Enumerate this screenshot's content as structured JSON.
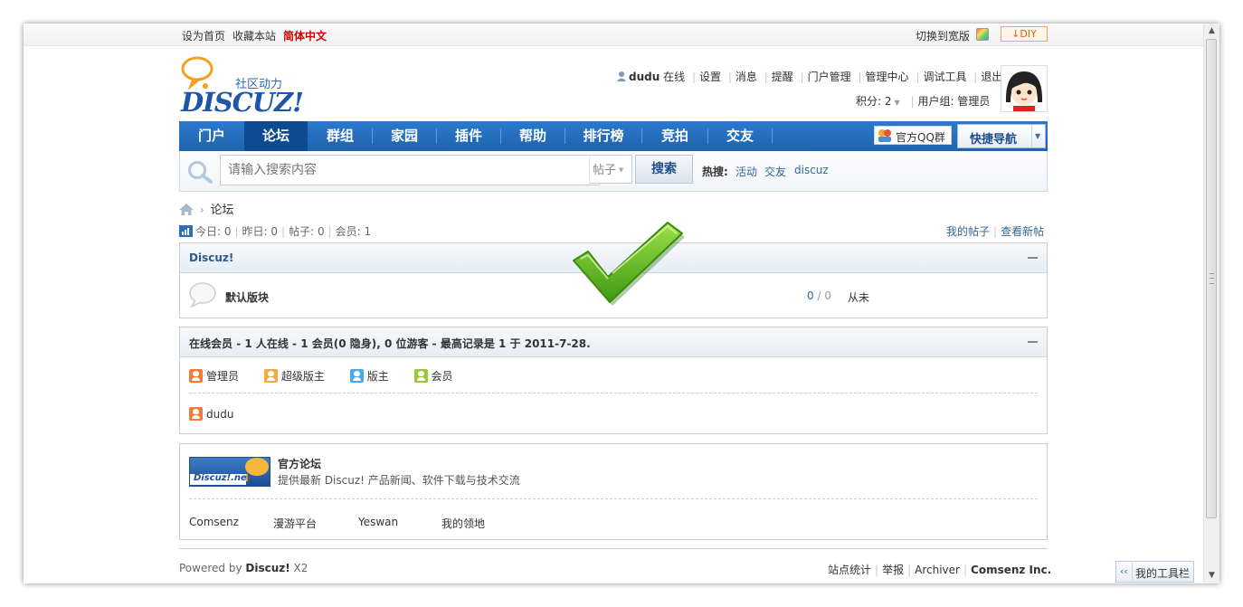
{
  "topbar": {
    "set_home": "设为首页",
    "bookmark": "收藏本站",
    "language": "简体中文",
    "switch_wide": "切换到宽版",
    "diy": "DIY"
  },
  "logo": {
    "brand": "DISCUZ!",
    "tagline": "社区动力"
  },
  "user": {
    "name": "dudu",
    "status": "在线",
    "links": [
      "设置",
      "消息",
      "提醒",
      "门户管理",
      "管理中心",
      "调试工具",
      "退出"
    ],
    "points_label": "积分: 2",
    "group_label": "用户组: 管理员"
  },
  "nav": {
    "items": [
      "门户",
      "论坛",
      "群组",
      "家园",
      "插件",
      "帮助",
      "排行榜",
      "竞拍",
      "交友"
    ],
    "active": "论坛",
    "qq_group": "官方QQ群",
    "quick_nav": "快捷导航"
  },
  "search": {
    "placeholder": "请输入搜索内容",
    "type": "帖子",
    "button": "搜索",
    "hot_label": "热搜:",
    "hot_terms": [
      "活动",
      "交友",
      "discuz"
    ]
  },
  "breadcrumb": {
    "current": "论坛"
  },
  "stats": {
    "today": "今日: 0",
    "yesterday": "昨日: 0",
    "posts": "帖子: 0",
    "members": "会员: 1",
    "my_posts": "我的帖子",
    "new_posts": "查看新帖"
  },
  "forum_group": {
    "title": "Discuz!",
    "forums": [
      {
        "name": "默认版块",
        "threads": "0",
        "posts": "0",
        "last": "从未"
      }
    ]
  },
  "online": {
    "title": "在线会员",
    "summary": " - 1 人在线 - 1 会员(0 隐身), 0 位游客 - 最高记录是 1 于 2011-7-28.",
    "legend": [
      {
        "label": "管理员",
        "color": "#f07b3b"
      },
      {
        "label": "超级版主",
        "color": "#f2a94a"
      },
      {
        "label": "版主",
        "color": "#4aa9e6"
      },
      {
        "label": "会员",
        "color": "#9dc53a"
      }
    ],
    "users": [
      {
        "name": "dudu",
        "color": "#f07b3b"
      }
    ]
  },
  "links_panel": {
    "banner_text": "Discuz!.net",
    "title": "官方论坛",
    "desc": "提供最新 Discuz! 产品新闻、软件下载与技术交流",
    "links": [
      "Comsenz",
      "漫游平台",
      "Yeswan",
      "我的领地"
    ]
  },
  "footer": {
    "powered_prefix": "Powered by ",
    "powered_brand": "Discuz!",
    "powered_version": " X2",
    "links": [
      "站点统计",
      "举报",
      "Archiver"
    ],
    "company": "Comsenz Inc."
  },
  "toolbar": {
    "label": "我的工具栏",
    "arrow": "‹‹"
  }
}
